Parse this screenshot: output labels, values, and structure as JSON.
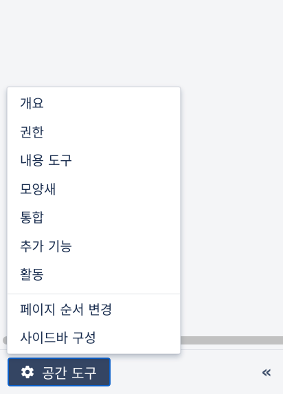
{
  "menu": {
    "items": [
      {
        "label": "개요"
      },
      {
        "label": "권한"
      },
      {
        "label": "내용 도구"
      },
      {
        "label": "모양새"
      },
      {
        "label": "통합"
      },
      {
        "label": "추가 기능"
      },
      {
        "label": "활동"
      }
    ],
    "secondary_items": [
      {
        "label": "페이지 순서 변경"
      },
      {
        "label": "사이드바 구성"
      }
    ]
  },
  "bottom_bar": {
    "space_tools_label": "공간 도구",
    "space_tools_icon": "gear-icon",
    "collapse_label": "«",
    "collapse_icon": "double-chevron-left-icon"
  },
  "colors": {
    "button_bg": "#344563",
    "button_border": "#0a5fc9",
    "text": "#172b4d",
    "background": "#f4f5f7"
  }
}
